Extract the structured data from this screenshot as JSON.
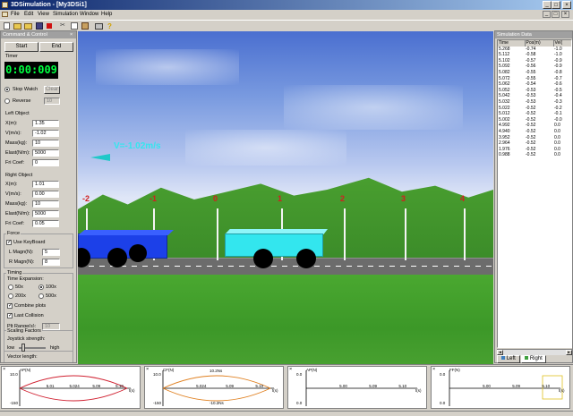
{
  "window": {
    "title": "3DSimulation - [My3DSi1]"
  },
  "menu": [
    "File",
    "Edit",
    "View",
    "Simulation",
    "Window",
    "Help"
  ],
  "control_panel": {
    "title": "Command & Control",
    "start_label": "Start",
    "end_label": "End",
    "timer_label": "Timer",
    "timer_value": "0:00:009",
    "stop_watch_label": "Stop Watch",
    "clear_label": "Clear",
    "reverse_label": "Reverse",
    "reverse_value": "10",
    "left_object": {
      "heading": "Left Object",
      "fields": [
        {
          "label": "X(m):",
          "value": "1.35"
        },
        {
          "label": "V(m/s):",
          "value": "-1.02"
        },
        {
          "label": "Mass(kg):",
          "value": "10"
        },
        {
          "label": "Elast(N/m):",
          "value": "5000"
        },
        {
          "label": "Fri Coef:",
          "value": "0"
        }
      ]
    },
    "right_object": {
      "heading": "Right Object",
      "fields": [
        {
          "label": "X(m):",
          "value": "1.01"
        },
        {
          "label": "V(m/s):",
          "value": "0.00"
        },
        {
          "label": "Mass(kg):",
          "value": "10"
        },
        {
          "label": "Elast(N/m):",
          "value": "5000"
        },
        {
          "label": "Fri Coef:",
          "value": "0.05"
        }
      ]
    },
    "force": {
      "heading": "Force",
      "use_keyboard_label": "Use KeyBoard",
      "l_magn_label": "L Magn(N):",
      "l_magn_value": "5",
      "r_magn_label": "R Magn(N):",
      "r_magn_value": "8"
    },
    "timing": {
      "heading": "Timing",
      "expansion_label": "Time Expansion:",
      "options": [
        "50x",
        "100x",
        "200x",
        "500x"
      ],
      "selected": "100x",
      "combine_plots_label": "Combine plots",
      "last_collision_label": "Last Collision",
      "plt_range_label": "Plt Range(s):",
      "plt_range_value": "10"
    },
    "scaling": {
      "heading": "Scaling Factors",
      "joystick_label": "Joystick strength:",
      "low_label": "low",
      "high_label": "high",
      "vector_length_label": "Vector length:"
    }
  },
  "scene": {
    "velocity_label": "V=-1.02m/s",
    "ticks": [
      "-2",
      "-1",
      "0",
      "1",
      "2",
      "3",
      "4"
    ],
    "colors": {
      "left_car": "#1c40e8",
      "right_car": "#33e6ee",
      "label": "#33e6ee"
    }
  },
  "sim_data": {
    "title": "Simulation Data",
    "columns": [
      "Time",
      "Pos(m)",
      "Vel("
    ],
    "rows": [
      [
        "5.268",
        "-0.74",
        "-1.0"
      ],
      [
        "5.112",
        "-0.58",
        "-1.0"
      ],
      [
        "5.102",
        "-0.57",
        "-0.9"
      ],
      [
        "5.092",
        "-0.56",
        "-0.9"
      ],
      [
        "5.082",
        "-0.55",
        "-0.8"
      ],
      [
        "5.072",
        "-0.55",
        "-0.7"
      ],
      [
        "5.062",
        "-0.54",
        "-0.6"
      ],
      [
        "5.052",
        "-0.53",
        "-0.5"
      ],
      [
        "5.042",
        "-0.53",
        "-0.4"
      ],
      [
        "5.032",
        "-0.53",
        "-0.3"
      ],
      [
        "5.022",
        "-0.52",
        "-0.2"
      ],
      [
        "5.012",
        "-0.52",
        "-0.1"
      ],
      [
        "5.002",
        "-0.52",
        "-0.0"
      ],
      [
        "4.992",
        "-0.52",
        "0.0"
      ],
      [
        "4.940",
        "-0.52",
        "0.0"
      ],
      [
        "3.952",
        "-0.52",
        "0.0"
      ],
      [
        "2.964",
        "-0.52",
        "0.0"
      ],
      [
        "1.976",
        "-0.52",
        "0.0"
      ],
      [
        "0.988",
        "-0.52",
        "0.0"
      ]
    ],
    "tabs": [
      "Left",
      "Right"
    ]
  },
  "plots": [
    {
      "ylabel": "AP(N)",
      "ymax": "10.0",
      "ymin": "-150",
      "xticks": [
        "5.01",
        "5.024",
        "5.09",
        "5.10"
      ],
      "xlabel": "t(s)",
      "color": "#d02030"
    },
    {
      "ylabel": "CF(N)",
      "ymax": "10.0",
      "ymin": "-150",
      "annotation_top": "10.2Ns",
      "annotation_bottom": "-10.2Ns",
      "xticks": [
        "5.024",
        "5.09",
        "5.10"
      ],
      "xlabel": "t(s)",
      "color": "#e08020"
    },
    {
      "ylabel": "AP(N)",
      "ymax": "0.0",
      "ymin": "0.0",
      "xticks": [
        "5.00",
        "5.09",
        "5.10"
      ],
      "xlabel": "t(s)",
      "color": "#000000"
    },
    {
      "ylabel": "FF(N)",
      "ymax": "0.0",
      "ymin": "0.0",
      "xticks": [
        "5.00",
        "5.09",
        "5.10"
      ],
      "xlabel": "t(s)",
      "color": "#e0c020"
    }
  ]
}
